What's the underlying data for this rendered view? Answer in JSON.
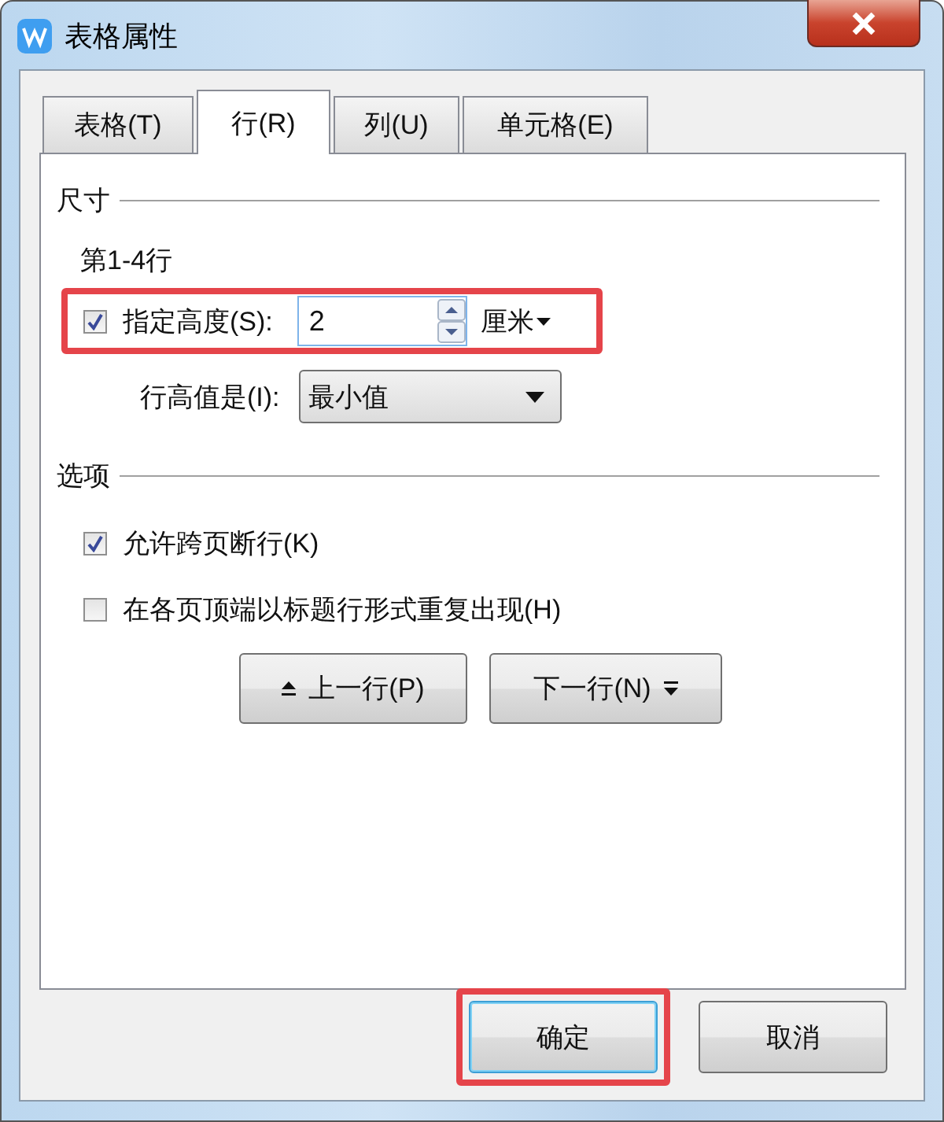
{
  "window": {
    "title": "表格属性"
  },
  "tabs": [
    {
      "label": "表格(T)",
      "selected": false
    },
    {
      "label": "行(R)",
      "selected": true
    },
    {
      "label": "列(U)",
      "selected": false
    },
    {
      "label": "单元格(E)",
      "selected": false
    }
  ],
  "size_section": {
    "heading": "尺寸",
    "rows_label": "第1-4行",
    "specify_height": {
      "label": "指定高度(S):",
      "checked": true,
      "value": "2",
      "unit": "厘米",
      "highlighted": true
    },
    "row_height_is": {
      "label": "行高值是(I):",
      "value": "最小值"
    }
  },
  "options_section": {
    "heading": "选项",
    "options": [
      {
        "label": "允许跨页断行(K)",
        "checked": true
      },
      {
        "label": "在各页顶端以标题行形式重复出现(H)",
        "checked": false
      }
    ]
  },
  "nav_buttons": [
    {
      "label": "上一行(P)",
      "kind": "previous"
    },
    {
      "label": "下一行(N)",
      "kind": "next"
    }
  ],
  "dialog_buttons": [
    {
      "label": "确定",
      "default": true,
      "highlighted": true
    },
    {
      "label": "取消",
      "default": false,
      "highlighted": false
    }
  ]
}
